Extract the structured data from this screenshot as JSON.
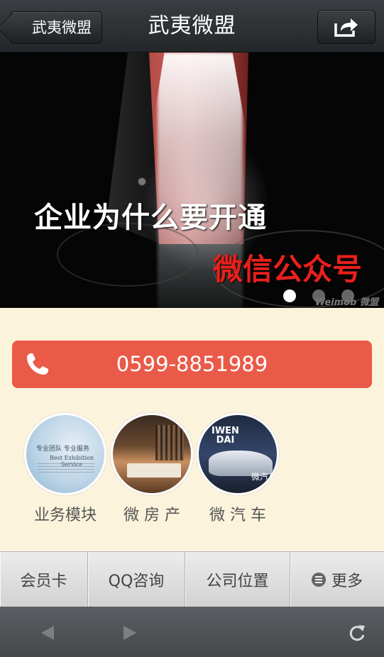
{
  "header": {
    "back_label": "武夷微盟",
    "title": "武夷微盟",
    "share_icon": "share-icon"
  },
  "banner": {
    "line1": "企业为什么要开通",
    "line2": "微信公众号",
    "watermark": "Weimob 微盟",
    "slide_count": 3,
    "active_slide": 1,
    "colors": {
      "accent_red": "#e8201c"
    }
  },
  "contact": {
    "phone": "0599-8851989",
    "icon": "phone-icon",
    "color": "#ea5a48"
  },
  "modules": [
    {
      "label": "业务模块",
      "image": "exhibition-service-thumbnail",
      "image_text": [
        "专业团队 专业服务",
        "Best Exhibition Service"
      ]
    },
    {
      "label": "微 房 产",
      "image": "interior-room-thumbnail"
    },
    {
      "label": "微 汽 车",
      "image": "sports-car-thumbnail",
      "image_text": [
        "IWEN",
        "DAI",
        "微汽车"
      ]
    }
  ],
  "menu": [
    {
      "label": "会员卡"
    },
    {
      "label": "QQ咨询"
    },
    {
      "label": "公司位置"
    },
    {
      "label": "更多",
      "icon": "menu-list-icon"
    }
  ],
  "toolbar": {
    "back_icon": "back-arrow-icon",
    "forward_icon": "forward-arrow-icon",
    "refresh_icon": "refresh-icon"
  }
}
